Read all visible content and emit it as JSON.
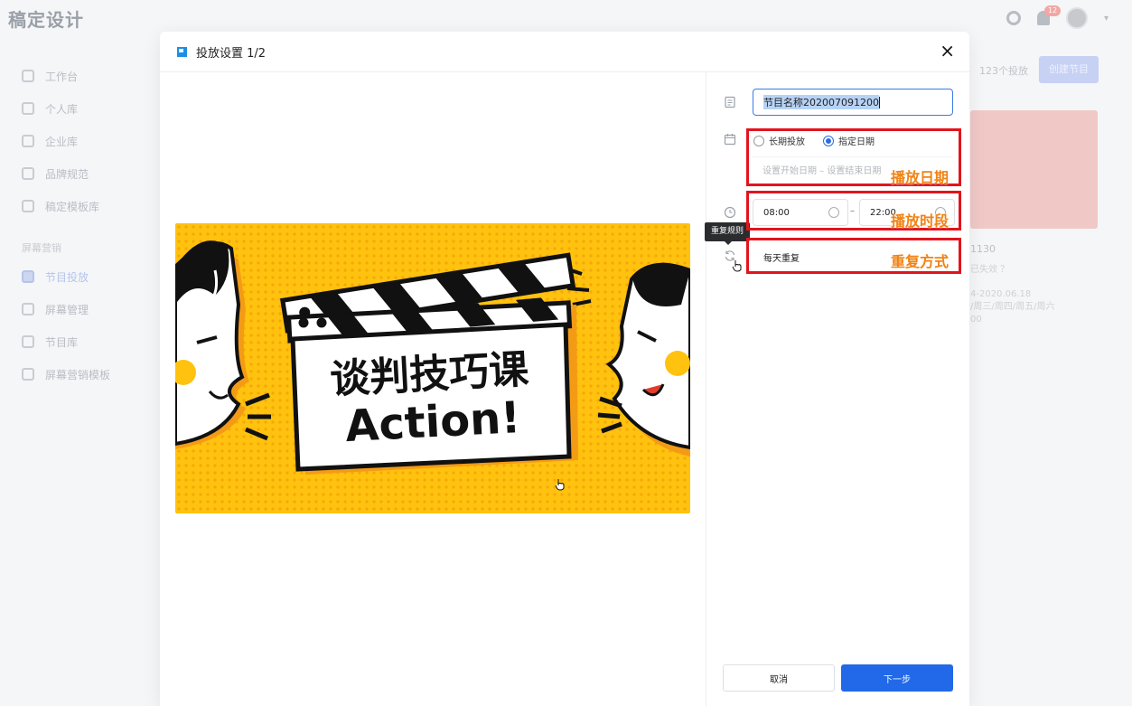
{
  "app": {
    "logo": "稿定设计",
    "notification_count": "12",
    "sidebar": {
      "items": [
        {
          "label": "工作台"
        },
        {
          "label": "个人库"
        },
        {
          "label": "企业库"
        },
        {
          "label": "品牌规范"
        },
        {
          "label": "稿定模板库"
        }
      ],
      "group_label": "屏幕营销",
      "group_items": [
        {
          "label": "节目投放",
          "active": true
        },
        {
          "label": "屏幕管理"
        },
        {
          "label": "节目库"
        },
        {
          "label": "屏幕营销模板"
        }
      ]
    },
    "right_panel": {
      "count_text": "123个投放",
      "create_button": "创建节目",
      "card_title": "1130",
      "card_status": "已失效 ？",
      "card_meta_1": "4-2020.06.18",
      "card_meta_2": "/周三/周四/周五/周六",
      "card_meta_3": "00"
    }
  },
  "modal": {
    "title": "投放设置 1/2",
    "close_label": "×",
    "preview": {
      "headline": "谈判技巧课",
      "subline": "Action!"
    },
    "form": {
      "program_name_value_selected": "节目名称202007091200",
      "radio_options": [
        {
          "label": "长期投放",
          "checked": false
        },
        {
          "label": "指定日期",
          "checked": true
        }
      ],
      "date_range_placeholder": "设置开始日期 – 设置结束日期",
      "time_start": "08:00",
      "time_end": "22:00",
      "time_separator": "–",
      "repeat_value": "每天重复",
      "repeat_tooltip": "重复规则"
    },
    "annotations": {
      "play_date": "播放日期",
      "play_period": "播放时段",
      "repeat_mode": "重复方式"
    },
    "buttons": {
      "cancel": "取消",
      "next": "下一步"
    }
  },
  "colors": {
    "primary": "#2169e8",
    "annotation_border": "#e2141d",
    "annotation_text": "#f08314",
    "preview_bg": "#ffc20e"
  }
}
